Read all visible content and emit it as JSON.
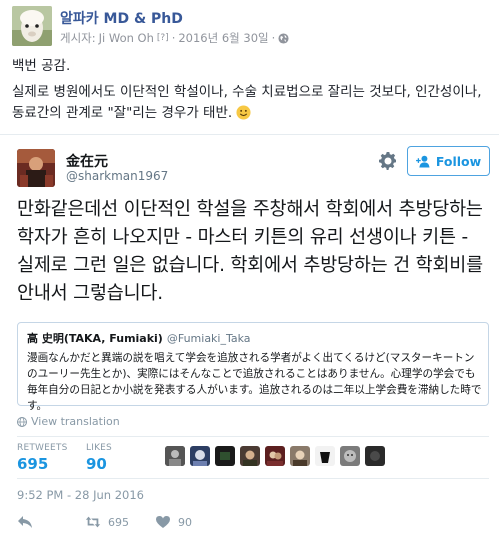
{
  "post": {
    "page_name": "알파카 MD & PhD",
    "poster_prefix": "게시자: ",
    "poster_name": "Ji Won Oh",
    "help_marker": "[?]",
    "separator": "·",
    "date": "2016년 6월 30일",
    "audience_icon": "globe-icon",
    "paragraph1": "백번 공감.",
    "paragraph2": "실제로 병원에서도 이단적인 학설이나, 수술 치료법으로 잘리는 것보다, 인간성이나, 동료간의 관계로 \"잘\"리는 경우가 태반.",
    "emoji": "smile-emoji"
  },
  "tweet": {
    "author_name": "金在元",
    "author_handle": "@sharkman1967",
    "follow_label": "Follow",
    "body": "만화같은데선 이단적인 학설을 주창해서 학회에서 추방당하는 학자가 흔히 나오지만 - 마스터 키튼의 유리 선생이나 키튼 - 실제로 그런 일은 없습니다. 학회에서 추방당하는 건 학회비를 안내서 그렇습니다.",
    "quote": {
      "name": "高 史明(TAKA, Fumiaki)",
      "handle": "@Fumiaki_Taka",
      "text": "漫画なんかだと異端の説を唱えて学会を追放される学者がよく出てくるけど(マスターキートンのユーリー先生とか)、実際にはそんなことで追放されることはありません。心理学の学会でも毎年自分の日記とか小説を発表する人がいます。追放されるのは二年以上学会費を滞納した時です。"
    },
    "view_translation": "View translation",
    "retweets_label": "RETWEETS",
    "retweets_count": "695",
    "likes_label": "LIKES",
    "likes_count": "90",
    "timestamp": "9:52 PM - 28 Jun 2016",
    "actions": {
      "retweet_count": "695",
      "like_count": "90"
    }
  },
  "colors": {
    "facebook_link": "#385898",
    "twitter_blue": "#1b95e0",
    "muted": "#8899a6"
  }
}
